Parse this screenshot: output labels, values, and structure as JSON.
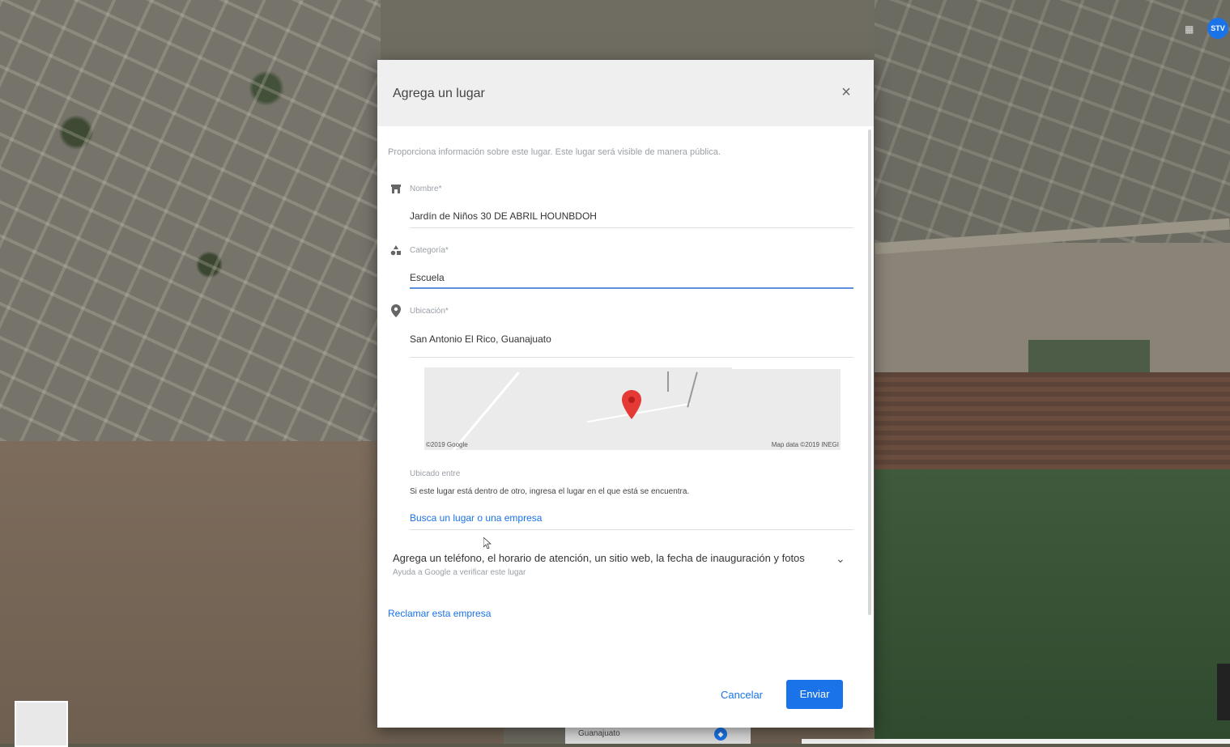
{
  "dialog": {
    "title": "Agrega un lugar",
    "close_icon": "×",
    "intro": "Proporciona información sobre este lugar. Este lugar será visible de manera pública.",
    "fields": {
      "name": {
        "label": "Nombre*",
        "value": "Jardín de Niños 30 DE ABRIL HOUNBDOH",
        "icon": "store-icon"
      },
      "category": {
        "label": "Categoría*",
        "value": "Escuela",
        "icon": "category-icon"
      },
      "location": {
        "label": "Ubicación*",
        "value": "San Antonio El Rico, Guanajuato",
        "icon": "location-pin-icon"
      }
    },
    "minimap": {
      "credit_left": "©2019 Google",
      "credit_right": "Map data ©2019 INEGI"
    },
    "located_within": {
      "label": "Ubicado entre",
      "description": "Si este lugar está dentro de otro, ingresa el lugar en el que está se encuentra.",
      "link": "Busca un lugar o una empresa"
    },
    "more_details": {
      "title": "Agrega un teléfono, el horario de atención, un sitio web, la fecha de inauguración y fotos",
      "subtitle": "Ayuda a Google a verificar este lugar"
    },
    "claim_link": "Reclamar esta empresa",
    "cancel_label": "Cancelar",
    "send_label": "Enviar"
  },
  "map_ui": {
    "badge": "STV",
    "bottom_search_text": "Guanajuato"
  }
}
